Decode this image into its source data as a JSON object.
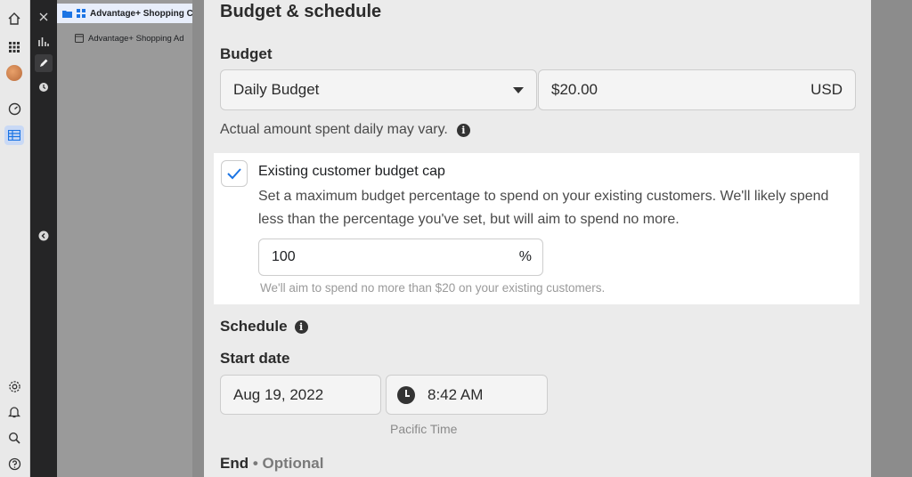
{
  "sidebar": {
    "campaign": "Advantage+ Shopping Campaign",
    "ad": "Advantage+ Shopping Ad"
  },
  "section": {
    "title": "Budget & schedule",
    "budget_label": "Budget",
    "budget_type": "Daily Budget",
    "amount": "$20.00",
    "currency": "USD",
    "hint": "Actual amount spent daily may vary.",
    "info_glyph": "i"
  },
  "cap": {
    "title": "Existing customer budget cap",
    "description": "Set a maximum budget percentage to spend on your existing customers. We'll likely spend less than the percentage you've set, but will aim to spend no more.",
    "value": "100",
    "unit": "%",
    "hint": "We'll aim to spend no more than $20 on your existing customers.",
    "checked": true
  },
  "schedule": {
    "label": "Schedule",
    "start_label": "Start date",
    "start_date": "Aug 19, 2022",
    "start_time": "8:42 AM",
    "timezone": "Pacific Time",
    "end_label": "End",
    "end_optional": "• Optional"
  },
  "colors": {
    "accent": "#1b74e4",
    "highlight": "#ffffff",
    "card": "#ebebeb"
  }
}
